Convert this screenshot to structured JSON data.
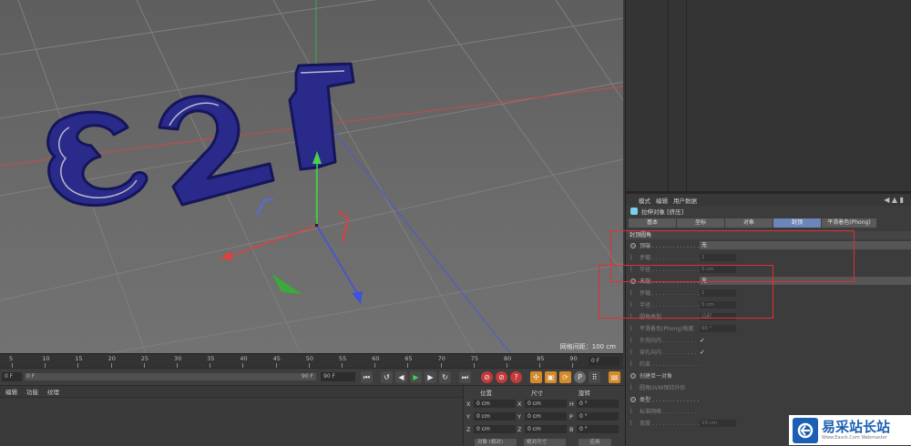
{
  "viewport": {
    "grid_spacing_label": "网格间距：100 cm",
    "model_text": "123"
  },
  "timeline": {
    "ticks": [
      "5",
      "10",
      "15",
      "20",
      "25",
      "30",
      "35",
      "40",
      "45",
      "50",
      "55",
      "60",
      "65",
      "70",
      "75",
      "80",
      "85",
      "90"
    ],
    "frame_right": "0 F"
  },
  "transport": {
    "start_frame": "0 F",
    "slider_start": "0 F",
    "slider_end": "90 F",
    "end_frame": "90 F"
  },
  "material_pane": {
    "menu": [
      "编辑",
      "功能",
      "纹理"
    ]
  },
  "coord_pane": {
    "headers": [
      "位置",
      "尺寸",
      "旋转"
    ],
    "rows": [
      {
        "axis": "X",
        "pos": "0 cm",
        "size_axis": "X",
        "size": "0 cm",
        "rot_axis": "H",
        "rot": "0 °"
      },
      {
        "axis": "Y",
        "pos": "0 cm",
        "size_axis": "Y",
        "size": "0 cm",
        "rot_axis": "P",
        "rot": "0 °"
      },
      {
        "axis": "Z",
        "pos": "0 cm",
        "size_axis": "Z",
        "size": "0 cm",
        "rot_axis": "B",
        "rot": "0 °"
      }
    ],
    "bottom_left": "对象 (相对)",
    "bottom_mid": "绝对尺寸",
    "bottom_right": "应用"
  },
  "attributes": {
    "menu": [
      "模式",
      "编辑",
      "用户数据"
    ],
    "object_title": "拉伸对象 [挤压]",
    "tabs": [
      {
        "label": "基本",
        "active": false
      },
      {
        "label": "坐标",
        "active": false
      },
      {
        "label": "对象",
        "active": false
      },
      {
        "label": "封顶",
        "active": true
      },
      {
        "label": "平滑着色(Phong)",
        "active": false
      }
    ],
    "section_title": "封顶圆角",
    "rows": [
      {
        "kind": "radio",
        "label": "顶端 . . . . . . . . . . . . . .",
        "control": "select",
        "value": "无"
      },
      {
        "kind": "sub",
        "label": "步幅 . . . . . . . . . . . . . .",
        "control": "field",
        "value": "1"
      },
      {
        "kind": "sub",
        "label": "半径 . . . . . . . . . . . . . .",
        "control": "field",
        "value": "5 cm"
      },
      {
        "kind": "radio",
        "label": "末端 . . . . . . . . . . . . . .",
        "control": "select",
        "value": "无"
      },
      {
        "kind": "sub",
        "label": "步幅 . . . . . . . . . . . . . .",
        "control": "field",
        "value": "1"
      },
      {
        "kind": "sub",
        "label": "半径 . . . . . . . . . . . . . .",
        "control": "field",
        "value": "5 cm"
      },
      {
        "kind": "sub",
        "label": "圆角类型 . . . . . . . . . .",
        "control": "field",
        "value": "凸起"
      },
      {
        "kind": "sub",
        "label": "平滑着色(Phong)角度",
        "control": "field",
        "value": "60 °"
      },
      {
        "kind": "sub",
        "label": "外壳向内 . . . . . . . . . .",
        "control": "check",
        "value": "✓"
      },
      {
        "kind": "sub",
        "label": "穿孔向内 . . . . . . . . . .",
        "control": "check",
        "value": "✓"
      },
      {
        "kind": "sub",
        "label": "约束 . . . . . . . . . . . . . .",
        "control": "none",
        "value": ""
      },
      {
        "kind": "radio",
        "label": "创建单一对象",
        "control": "none",
        "value": ""
      },
      {
        "kind": "sub",
        "label": "圆角UVW保持外形",
        "control": "none",
        "value": ""
      },
      {
        "kind": "radio",
        "label": "类型 . . . . . . . . . . . . . .",
        "control": "none",
        "value": ""
      },
      {
        "kind": "sub",
        "label": "标准网格 . . . . . . . . . .",
        "control": "none",
        "value": ""
      },
      {
        "kind": "sub",
        "label": "宽度 . . . . . . . . . . . . . .",
        "control": "field",
        "value": "10 cm"
      }
    ]
  },
  "watermark": {
    "title": "易采站长站",
    "subtitle": "Www.Easck.Com  Webmaster"
  }
}
